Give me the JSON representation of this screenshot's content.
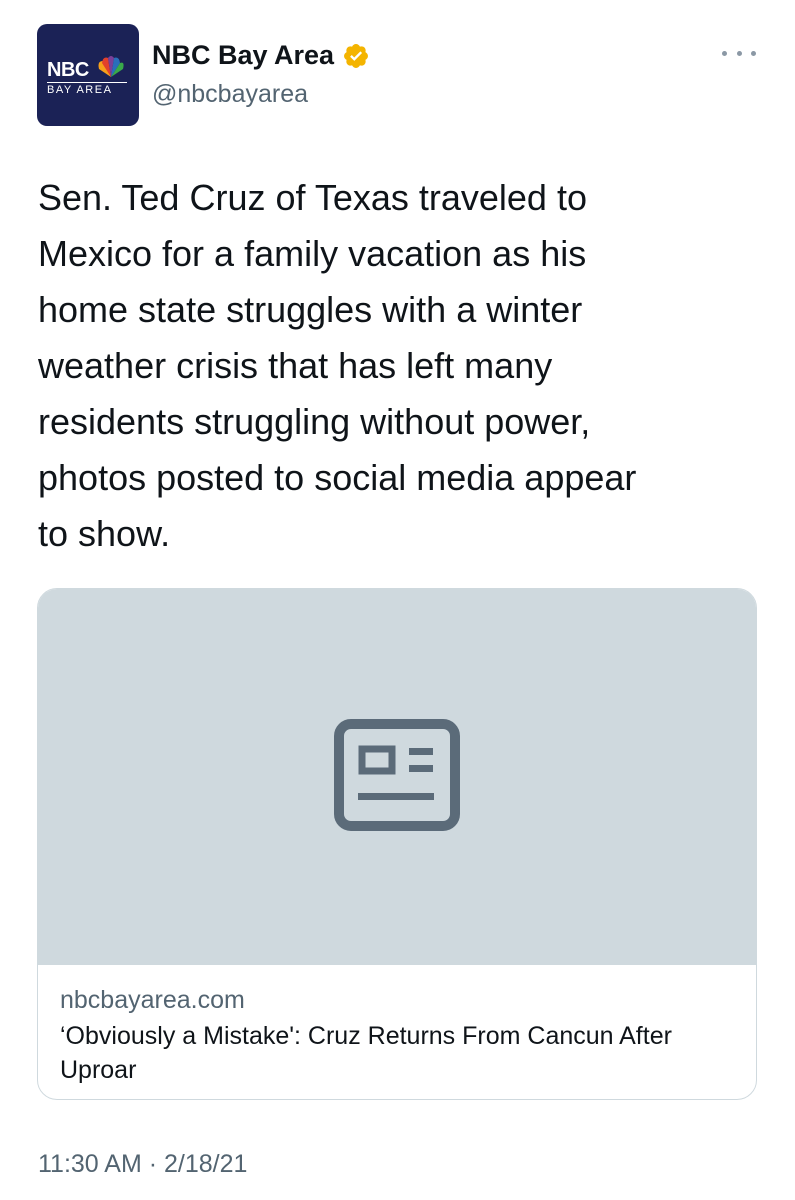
{
  "author": {
    "display_name": "NBC Bay Area",
    "handle": "@nbcbayarea",
    "avatar_logo_top": "NBC",
    "avatar_logo_bottom": "BAY AREA",
    "verified_icon": "verified-badge-icon",
    "verified_color": "#f4b400"
  },
  "more_menu_icon": "more-dots-icon",
  "tweet": {
    "text": "Sen. Ted Cruz of Texas traveled to\nMexico for a family vacation as his\nhome state struggles with a winter\nweather crisis that has left many\nresidents struggling without power,\nphotos posted to social media appear\nto show."
  },
  "link_card": {
    "placeholder_icon": "article-icon",
    "domain": "nbcbayarea.com",
    "title": "‘Obviously a Mistake': Cruz Returns From Cancun After Uproar"
  },
  "meta": {
    "timestamp": "11:30 AM · 2/18/21"
  },
  "colors": {
    "text_primary": "#0f1419",
    "text_secondary": "#536471",
    "card_placeholder": "#cfd9de",
    "avatar_bg": "#1b2256"
  }
}
